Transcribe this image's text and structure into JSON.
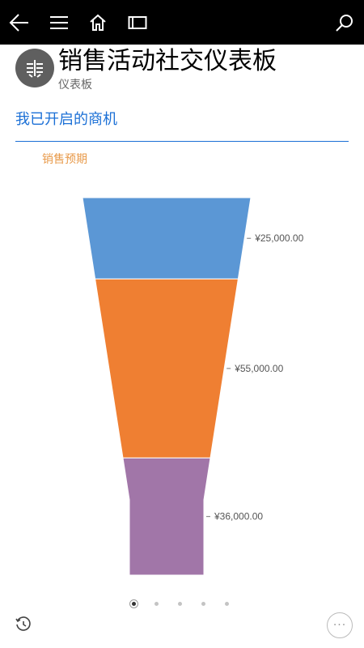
{
  "toolbar": {
    "icons": [
      "back-arrow-icon",
      "hamburger-menu-icon",
      "home-icon",
      "window-icon",
      "search-icon"
    ]
  },
  "header": {
    "title": "销售活动社交仪表板",
    "subtitle": "仪表板",
    "avatar_icon": "dashboard-logo-icon"
  },
  "section": {
    "title": "我已开启的商机",
    "accent": "#1a6fd6"
  },
  "chart_data": {
    "type": "funnel",
    "title": "销售预期",
    "stages": [
      {
        "label": "¥25,000.00",
        "value": 25000,
        "color": "#5b97d5"
      },
      {
        "label": "¥55,000.00",
        "value": 55000,
        "color": "#ef7f32"
      },
      {
        "label": "¥36,000.00",
        "value": 36000,
        "color": "#a176a8"
      }
    ]
  },
  "pager": {
    "count": 5,
    "active_index": 0
  },
  "footer": {
    "history_icon": "history-clock-icon",
    "more_label": "···"
  }
}
